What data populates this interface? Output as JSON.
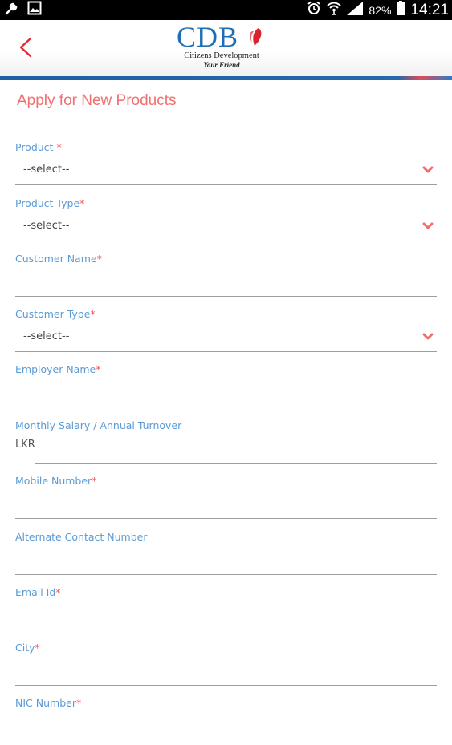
{
  "status_bar": {
    "battery": "82%",
    "time": "14:21"
  },
  "header": {
    "logo_text": "CDB",
    "logo_subtitle": "Citizens Development",
    "logo_tagline": "Your Friend"
  },
  "page_title": "Apply for New Products",
  "colors": {
    "accent": "#f07070",
    "label": "#5b9bd5",
    "required": "#f25555",
    "brand_blue": "#1c6fb6"
  },
  "form": {
    "product": {
      "label": "Product ",
      "required": "*",
      "value": "--select--"
    },
    "product_type": {
      "label": "Product Type",
      "required": "*",
      "value": "--select--"
    },
    "customer_name": {
      "label": "Customer Name",
      "required": "*"
    },
    "customer_type": {
      "label": "Customer Type",
      "required": "*",
      "value": "--select--"
    },
    "employer_name": {
      "label": "Employer Name",
      "required": "*"
    },
    "monthly_salary": {
      "label": "Monthly Salary / Annual Turnover",
      "prefix": "LKR"
    },
    "mobile_number": {
      "label": "Mobile Number",
      "required": "*"
    },
    "alternate_contact": {
      "label": "Alternate Contact Number"
    },
    "email": {
      "label": "Email Id",
      "required": "*"
    },
    "city": {
      "label": "City",
      "required": "*"
    },
    "nic_number": {
      "label": "NIC Number",
      "required": "*"
    }
  }
}
